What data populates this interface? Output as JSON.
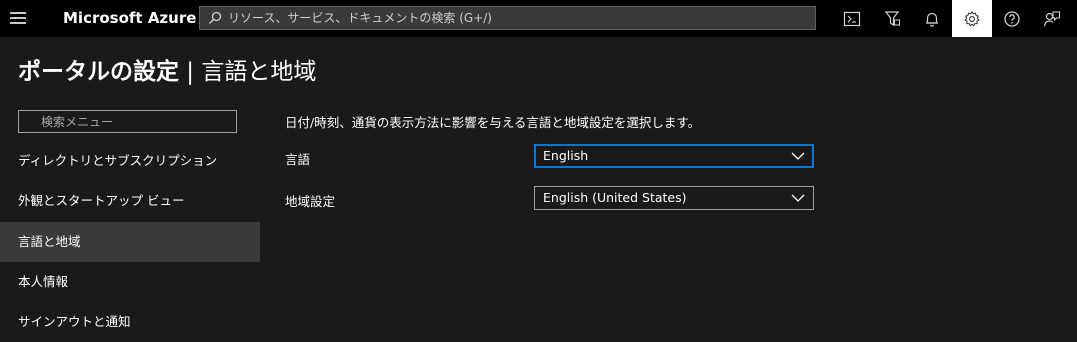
{
  "topbar": {
    "brand": "Microsoft Azure",
    "search_placeholder": "リソース、サービス、ドキュメントの検索 (G+/)",
    "icons": [
      "cloud-shell-icon",
      "directory-filter-icon",
      "bell-icon",
      "gear-icon",
      "help-icon",
      "feedback-icon"
    ]
  },
  "page": {
    "title_main": "ポータルの設定",
    "title_sep": " | ",
    "title_sub": "言語と地域"
  },
  "menu": {
    "search_placeholder": "検索メニュー",
    "items": [
      {
        "label": "ディレクトリとサブスクリプション"
      },
      {
        "label": "外観とスタートアップ ビュー"
      },
      {
        "label": "言語と地域"
      },
      {
        "label": "本人情報"
      },
      {
        "label": "サインアウトと通知"
      }
    ],
    "selected_index": 2
  },
  "main": {
    "description": "日付/時刻、通貨の表示方法に影響を与える言語と地域設定を選択します。",
    "language_label": "言語",
    "language_value": "English",
    "region_label": "地域設定",
    "region_value": "English (United States)"
  },
  "colors": {
    "background": "#1b1a19",
    "topbar": "#000000",
    "selected_item": "#3b3a39",
    "focus_border": "#0078d4"
  }
}
